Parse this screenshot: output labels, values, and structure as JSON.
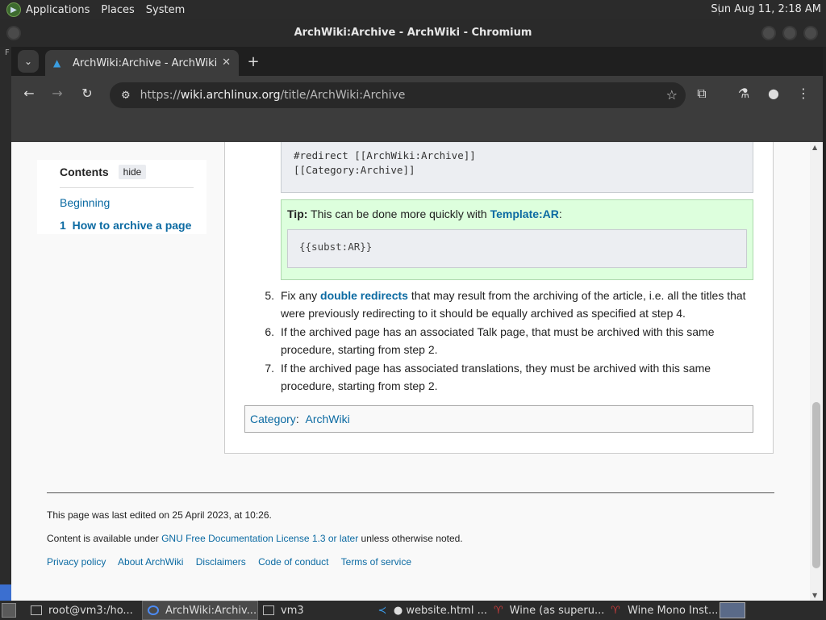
{
  "system_panel": {
    "menus": [
      "Applications",
      "Places",
      "System"
    ],
    "clock": "Sun Aug 11,  2:18 AM"
  },
  "window": {
    "title": "ArchWiki:Archive - ArchWiki - Chromium"
  },
  "left_strip": {
    "text": "F"
  },
  "browser": {
    "tab_title": "ArchWiki:Archive - ArchWiki",
    "url_prefix": "https://",
    "url_host": "wiki.archlinux.org",
    "url_path": "/title/ArchWiki:Archive"
  },
  "toc": {
    "title": "Contents",
    "hide_label": "hide",
    "items": [
      {
        "label": "Beginning"
      },
      {
        "number": "1",
        "label": "How to archive a page"
      }
    ]
  },
  "article": {
    "code1_line1": "#redirect [[ArchWiki:Archive]]",
    "code1_line2": "[[Category:Archive]]",
    "tip_label": "Tip:",
    "tip_text": " This can be done more quickly with ",
    "tip_link": "Template:AR",
    "tip_after": ":",
    "code2": "{{subst:AR}}",
    "steps": [
      {
        "num": "5.",
        "before": "Fix any ",
        "link": "double redirects",
        "after": " that may result from the archiving of the article, i.e. all the titles that were previously redirecting to it should be equally archived as specified at step 4."
      },
      {
        "num": "6.",
        "text": "If the archived page has an associated Talk page, that must be archived with this same procedure, starting from step 2."
      },
      {
        "num": "7.",
        "text": "If the archived page has associated translations, they must be archived with this same procedure, starting from step 2."
      }
    ],
    "category_label": "Category",
    "category_sep": ":",
    "category_link": "ArchWiki"
  },
  "footer": {
    "last_edited": "This page was last edited on 25 April 2023, at 10:26.",
    "license_before": "Content is available under ",
    "license_link": "GNU Free Documentation License 1.3 or later",
    "license_after": " unless otherwise noted.",
    "links": [
      "Privacy policy",
      "About ArchWiki",
      "Disclaimers",
      "Code of conduct",
      "Terms of service"
    ]
  },
  "taskbar": {
    "tasks": [
      "root@vm3:/ho...",
      "ArchWiki:Archiv...",
      "vm3",
      "● website.html ...",
      "Wine (as superu...",
      "Wine Mono Inst..."
    ]
  }
}
